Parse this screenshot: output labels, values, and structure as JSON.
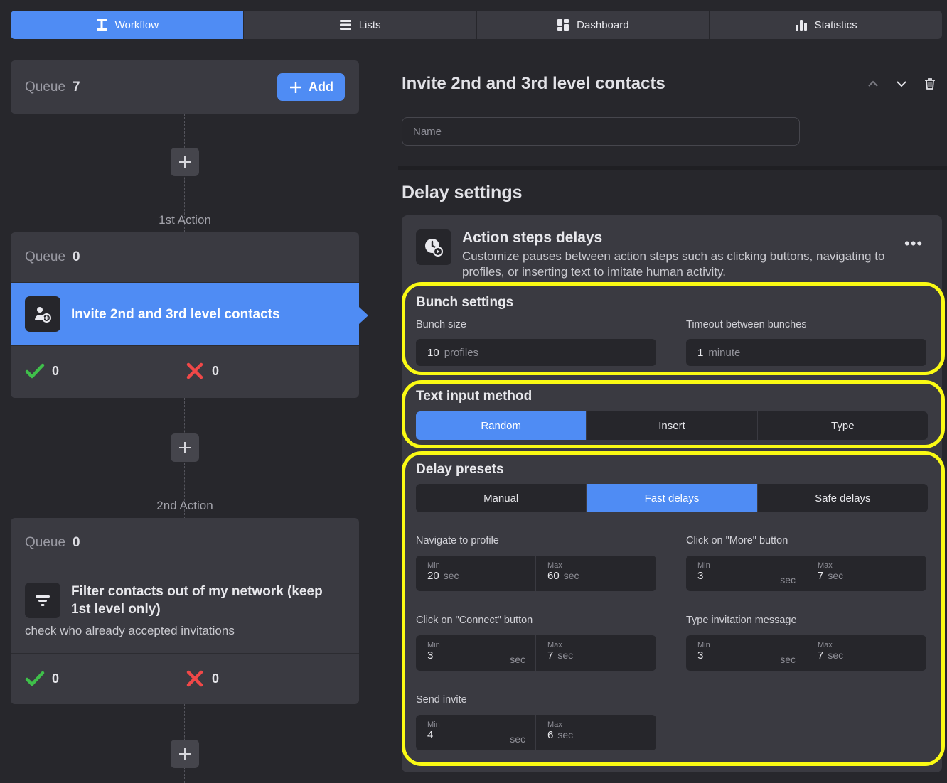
{
  "tabs": [
    {
      "label": "Workflow",
      "icon": "workflow-icon",
      "active": true
    },
    {
      "label": "Lists",
      "icon": "list-icon",
      "active": false
    },
    {
      "label": "Dashboard",
      "icon": "dashboard-icon",
      "active": false
    },
    {
      "label": "Statistics",
      "icon": "bar-chart-icon",
      "active": false
    }
  ],
  "top_queue": {
    "label": "Queue",
    "count": "7",
    "add_label": "Add"
  },
  "actions": [
    {
      "caption": "1st Action",
      "queue_label": "Queue",
      "queue_count": "0",
      "title": "Invite 2nd and 3rd level contacts",
      "success": "0",
      "fail": "0"
    },
    {
      "caption": "2nd Action",
      "queue_label": "Queue",
      "queue_count": "0",
      "title": "Filter contacts out of my network (keep 1st level only)",
      "subtitle": "check who already accepted invitations",
      "success": "0",
      "fail": "0"
    }
  ],
  "detail": {
    "title": "Invite 2nd and 3rd level contacts",
    "name_placeholder": "Name",
    "section_title": "Delay settings",
    "panel_title": "Action steps delays",
    "panel_desc": "Customize pauses between action steps such as clicking buttons, navigating to profiles, or inserting text to imitate human activity.",
    "bunch": {
      "title": "Bunch settings",
      "size_label": "Bunch size",
      "size_value": "10",
      "size_unit": "profiles",
      "timeout_label": "Timeout between bunches",
      "timeout_value": "1",
      "timeout_unit": "minute"
    },
    "text_input": {
      "title": "Text input method",
      "options": [
        "Random",
        "Insert",
        "Type"
      ],
      "selected": "Random"
    },
    "presets": {
      "title": "Delay presets",
      "options": [
        "Manual",
        "Fast delays",
        "Safe delays"
      ],
      "selected": "Fast delays",
      "min_label": "Min",
      "max_label": "Max",
      "unit": "sec",
      "items": [
        {
          "label": "Navigate to profile",
          "min": "20",
          "max": "60"
        },
        {
          "label": "Click on \"More\" button",
          "min": "3",
          "max": "7"
        },
        {
          "label": "Click on \"Connect\" button",
          "min": "3",
          "max": "7"
        },
        {
          "label": "Type invitation message",
          "min": "3",
          "max": "7"
        },
        {
          "label": "Send invite",
          "min": "4",
          "max": "6"
        }
      ]
    }
  },
  "colors": {
    "accent": "#4f8cf4",
    "highlight": "#fafa14",
    "success": "#3fbf4a",
    "fail": "#f04848"
  }
}
